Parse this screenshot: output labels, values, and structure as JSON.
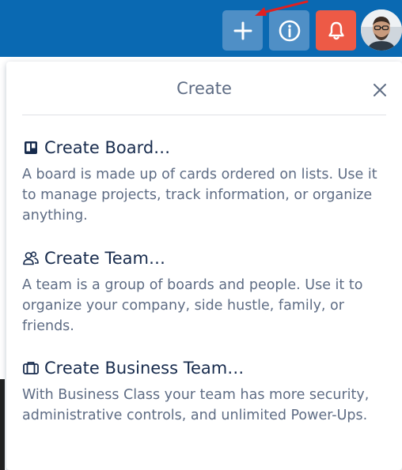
{
  "topbar": {
    "background_color": "#0a69b2",
    "buttons": [
      {
        "name": "create",
        "icon": "plus-icon"
      },
      {
        "name": "info",
        "icon": "info-icon"
      },
      {
        "name": "notifications",
        "icon": "bell-icon"
      }
    ],
    "notification_color": "#ed5a46"
  },
  "popover": {
    "title": "Create",
    "close_icon": "close-icon",
    "options": [
      {
        "icon": "board-icon",
        "title": "Create Board…",
        "description": "A board is made up of cards ordered on lists. Use it to manage projects, track information, or organize anything."
      },
      {
        "icon": "team-icon",
        "title": "Create Team…",
        "description": "A team is a group of boards and people. Use it to organize your company, side hustle, family, or friends."
      },
      {
        "icon": "briefcase-icon",
        "title": "Create Business Team…",
        "description": "With Business Class your team has more security, administrative controls, and unlimited Power-Ups."
      }
    ]
  },
  "annotation_color": "#e02020"
}
